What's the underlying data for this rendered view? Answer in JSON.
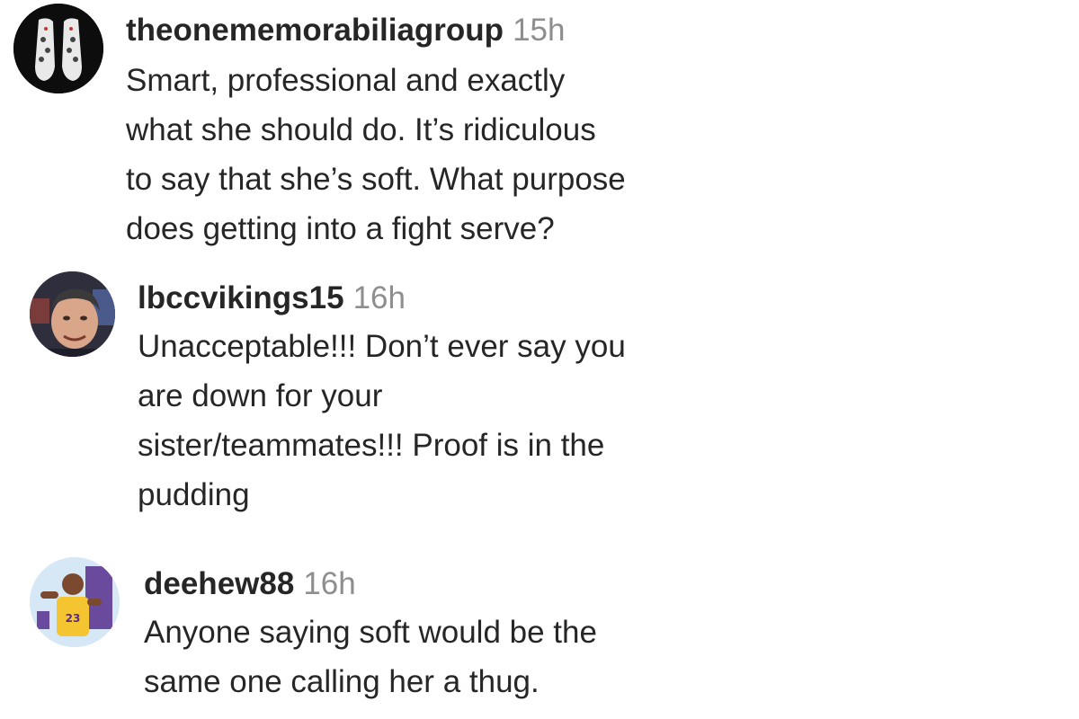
{
  "comments": [
    {
      "username": "theonememorabiliagroup",
      "time": "15h",
      "text": "Smart, professional and exactly\nwhat she should do. It’s ridiculous\nto say that she’s soft. What purpose\ndoes getting into a fight serve?",
      "avatar": "sneakers-avatar"
    },
    {
      "username": "lbccvikings15",
      "time": "16h",
      "text": "Unacceptable!!! Don’t ever say you\nare down for your\nsister/teammates!!! Proof is in the\npudding",
      "avatar": "man-face-avatar"
    },
    {
      "username": "deehew88",
      "time": "16h",
      "text": "Anyone saying soft would be the\nsame one calling her a thug.",
      "avatar": "basketball-player-avatar"
    }
  ],
  "colors": {
    "text": "#262626",
    "muted": "#8e8e8e",
    "background": "#ffffff"
  }
}
